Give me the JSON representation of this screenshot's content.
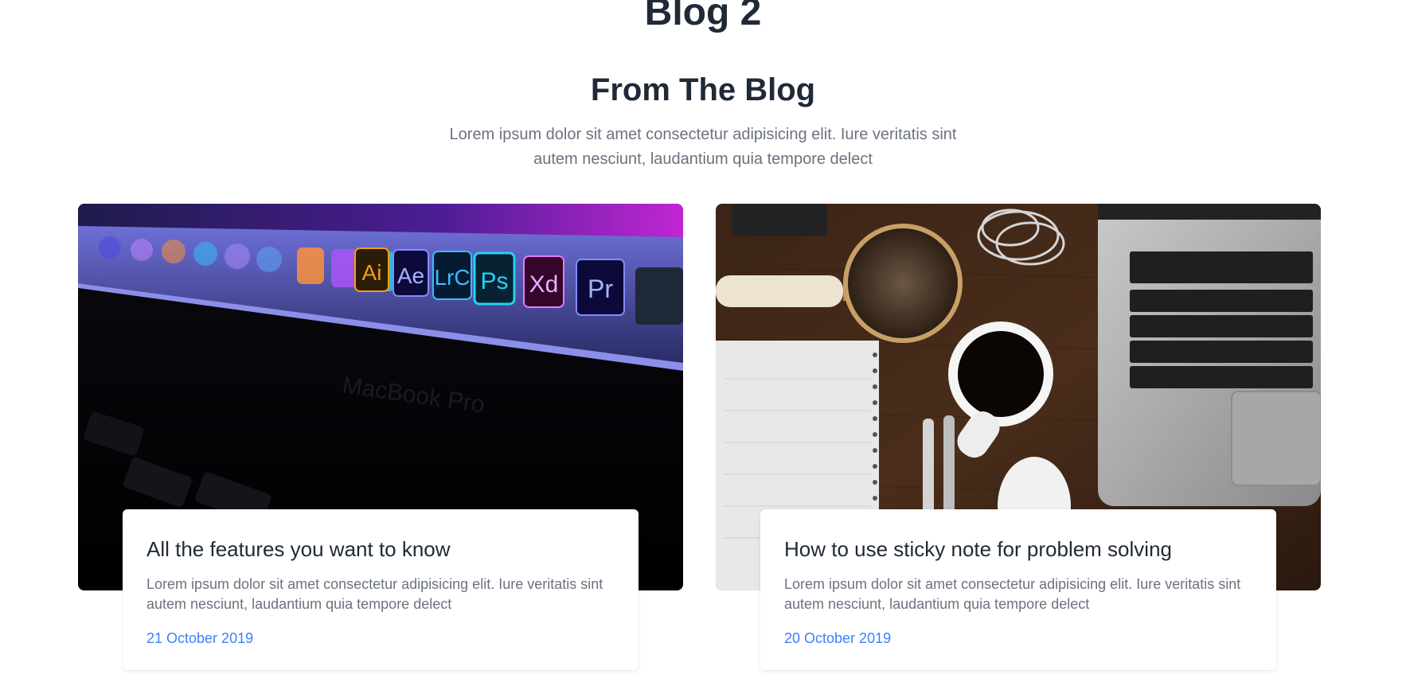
{
  "page": {
    "heading": "Blog 2"
  },
  "section": {
    "title": "From The Blog",
    "description": "Lorem ipsum dolor sit amet consectetur adipisicing elit. Iure veritatis sint autem nesciunt, laudantium quia tempore delect"
  },
  "posts": [
    {
      "title": "All the features you want to know",
      "excerpt": "Lorem ipsum dolor sit amet consectetur adipisicing elit. Iure veritatis sint autem nesciunt, laudantium quia tempore delect",
      "date": "21 October 2019",
      "image_label": "MacBook Pro",
      "dock_apps": [
        "Ai",
        "Ae",
        "LrC",
        "Ps",
        "Xd",
        "Pr"
      ]
    },
    {
      "title": "How to use sticky note for problem solving",
      "excerpt": "Lorem ipsum dolor sit amet consectetur adipisicing elit. Iure veritatis sint autem nesciunt, laudantium quia tempore delect",
      "date": "20 October 2019"
    }
  ],
  "colors": {
    "heading": "#1f2937",
    "body_text": "#6b7280",
    "date_link": "#3b82f6"
  }
}
